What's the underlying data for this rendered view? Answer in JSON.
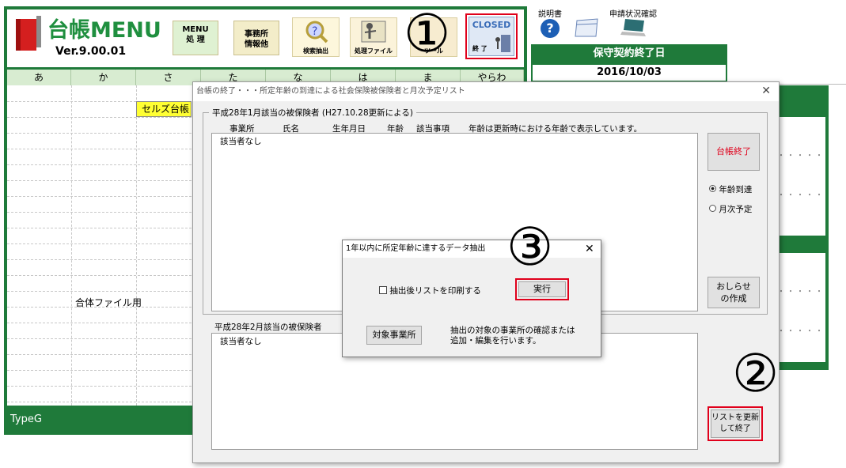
{
  "app": {
    "logo_text": "台帳MENU",
    "version": "Ver.9.00.01",
    "toolbar": {
      "menu_btn": "MENU\n処 理",
      "office_btn": "事務所\n情報他",
      "search_btn": "検索抽出",
      "process_btn": "処理ファイル",
      "tools_btn": "ツール",
      "closed_top": "CLOSED",
      "closed_btn": "終 了"
    },
    "help": {
      "manual_label": "説明書",
      "status_label": "申請状況確認"
    },
    "maintenance": {
      "label": "保守契約終了日",
      "date": "2016/10/03"
    },
    "columns": [
      "あ",
      "か",
      "さ",
      "た",
      "な",
      "は",
      "ま",
      "やらわ"
    ],
    "cells": {
      "cell_seruzu": "セルズ台帳",
      "cell_gattai": "合体ファイル用"
    },
    "footer": "TypeG"
  },
  "dialog_main": {
    "title": "台帳の終了・・・所定年齢の到達による社会保険被保険者と月次予定リスト",
    "group1_title": "平成28年1月該当の被保険者 (H27.10.28更新による)",
    "headers": [
      "事業所",
      "氏名",
      "生年月日",
      "年齢",
      "該当事項",
      "年齢は更新時における年齢で表示しています。"
    ],
    "list1_item": "該当者なし",
    "group2_title": "平成28年2月該当の被保険者",
    "list2_item": "該当者なし",
    "btn_end": "台帳終了",
    "radio_age": "年齢到達",
    "radio_monthly": "月次予定",
    "btn_notice": "おしらせ\nの作成",
    "btn_update": "リストを更新\nして終了"
  },
  "dialog_sub": {
    "title": "1年以内に所定年齢に達するデータ抽出",
    "checkbox_label": "抽出後リストを印刷する",
    "btn_run": "実行",
    "btn_office": "対象事業所",
    "desc": "抽出の対象の事業所の確認または\n追加・編集を行います。"
  },
  "annotations": {
    "one": "①",
    "two": "②",
    "three": "③"
  },
  "colors": {
    "green": "#1f7a3a",
    "red_highlight": "#e0001b",
    "header_green": "#d8ecd1"
  }
}
